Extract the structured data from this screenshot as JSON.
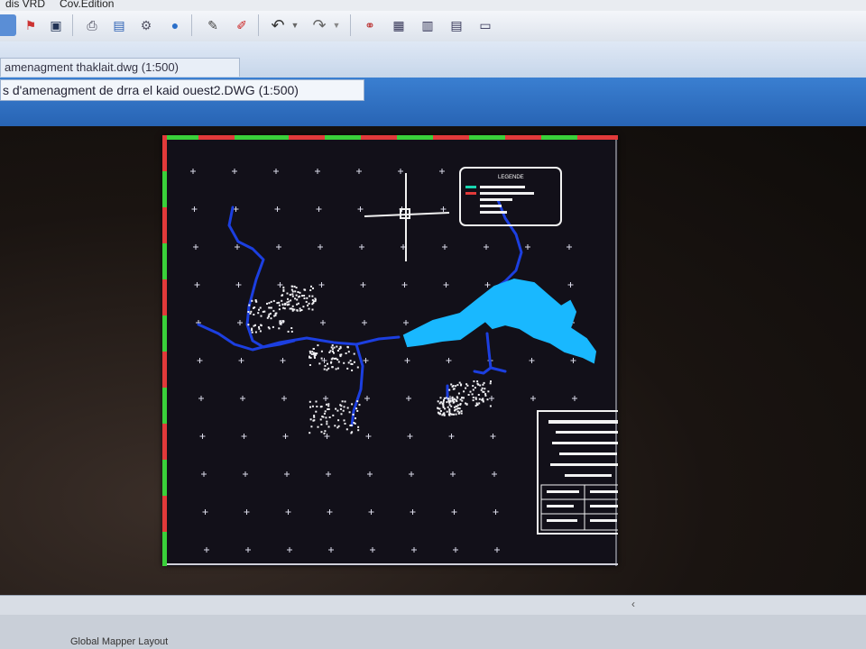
{
  "menu": {
    "items": [
      "dis VRD",
      "Cov.Edition"
    ]
  },
  "toolbar": {
    "icons": [
      "layers-icon",
      "flag-icon",
      "save-icon",
      "print-icon",
      "preview-icon",
      "settings-icon",
      "globe-icon",
      "pen-icon",
      "eraser-icon",
      "undo-icon",
      "dropdown-icon",
      "redo-icon",
      "dropdown-icon",
      "network-icon",
      "grid-icon",
      "chart-icon",
      "table-icon",
      "window-icon"
    ]
  },
  "tabs": {
    "tab1": "amenagment thaklait.dwg (1:500)",
    "tab2": "s d'amenagment de drra el kaid ouest2.DWG (1:500)"
  },
  "drawing": {
    "legend_title": "LEGENDE",
    "colors": {
      "river": "#1c3fe0",
      "lake": "#19b8ff",
      "buildings": "#ffffff",
      "crosses": "#d8d8e6",
      "frame_red": "#e23a3a",
      "frame_green": "#3ad13a"
    }
  },
  "bottom": {
    "layout_tab": "Global Mapper Layout"
  }
}
